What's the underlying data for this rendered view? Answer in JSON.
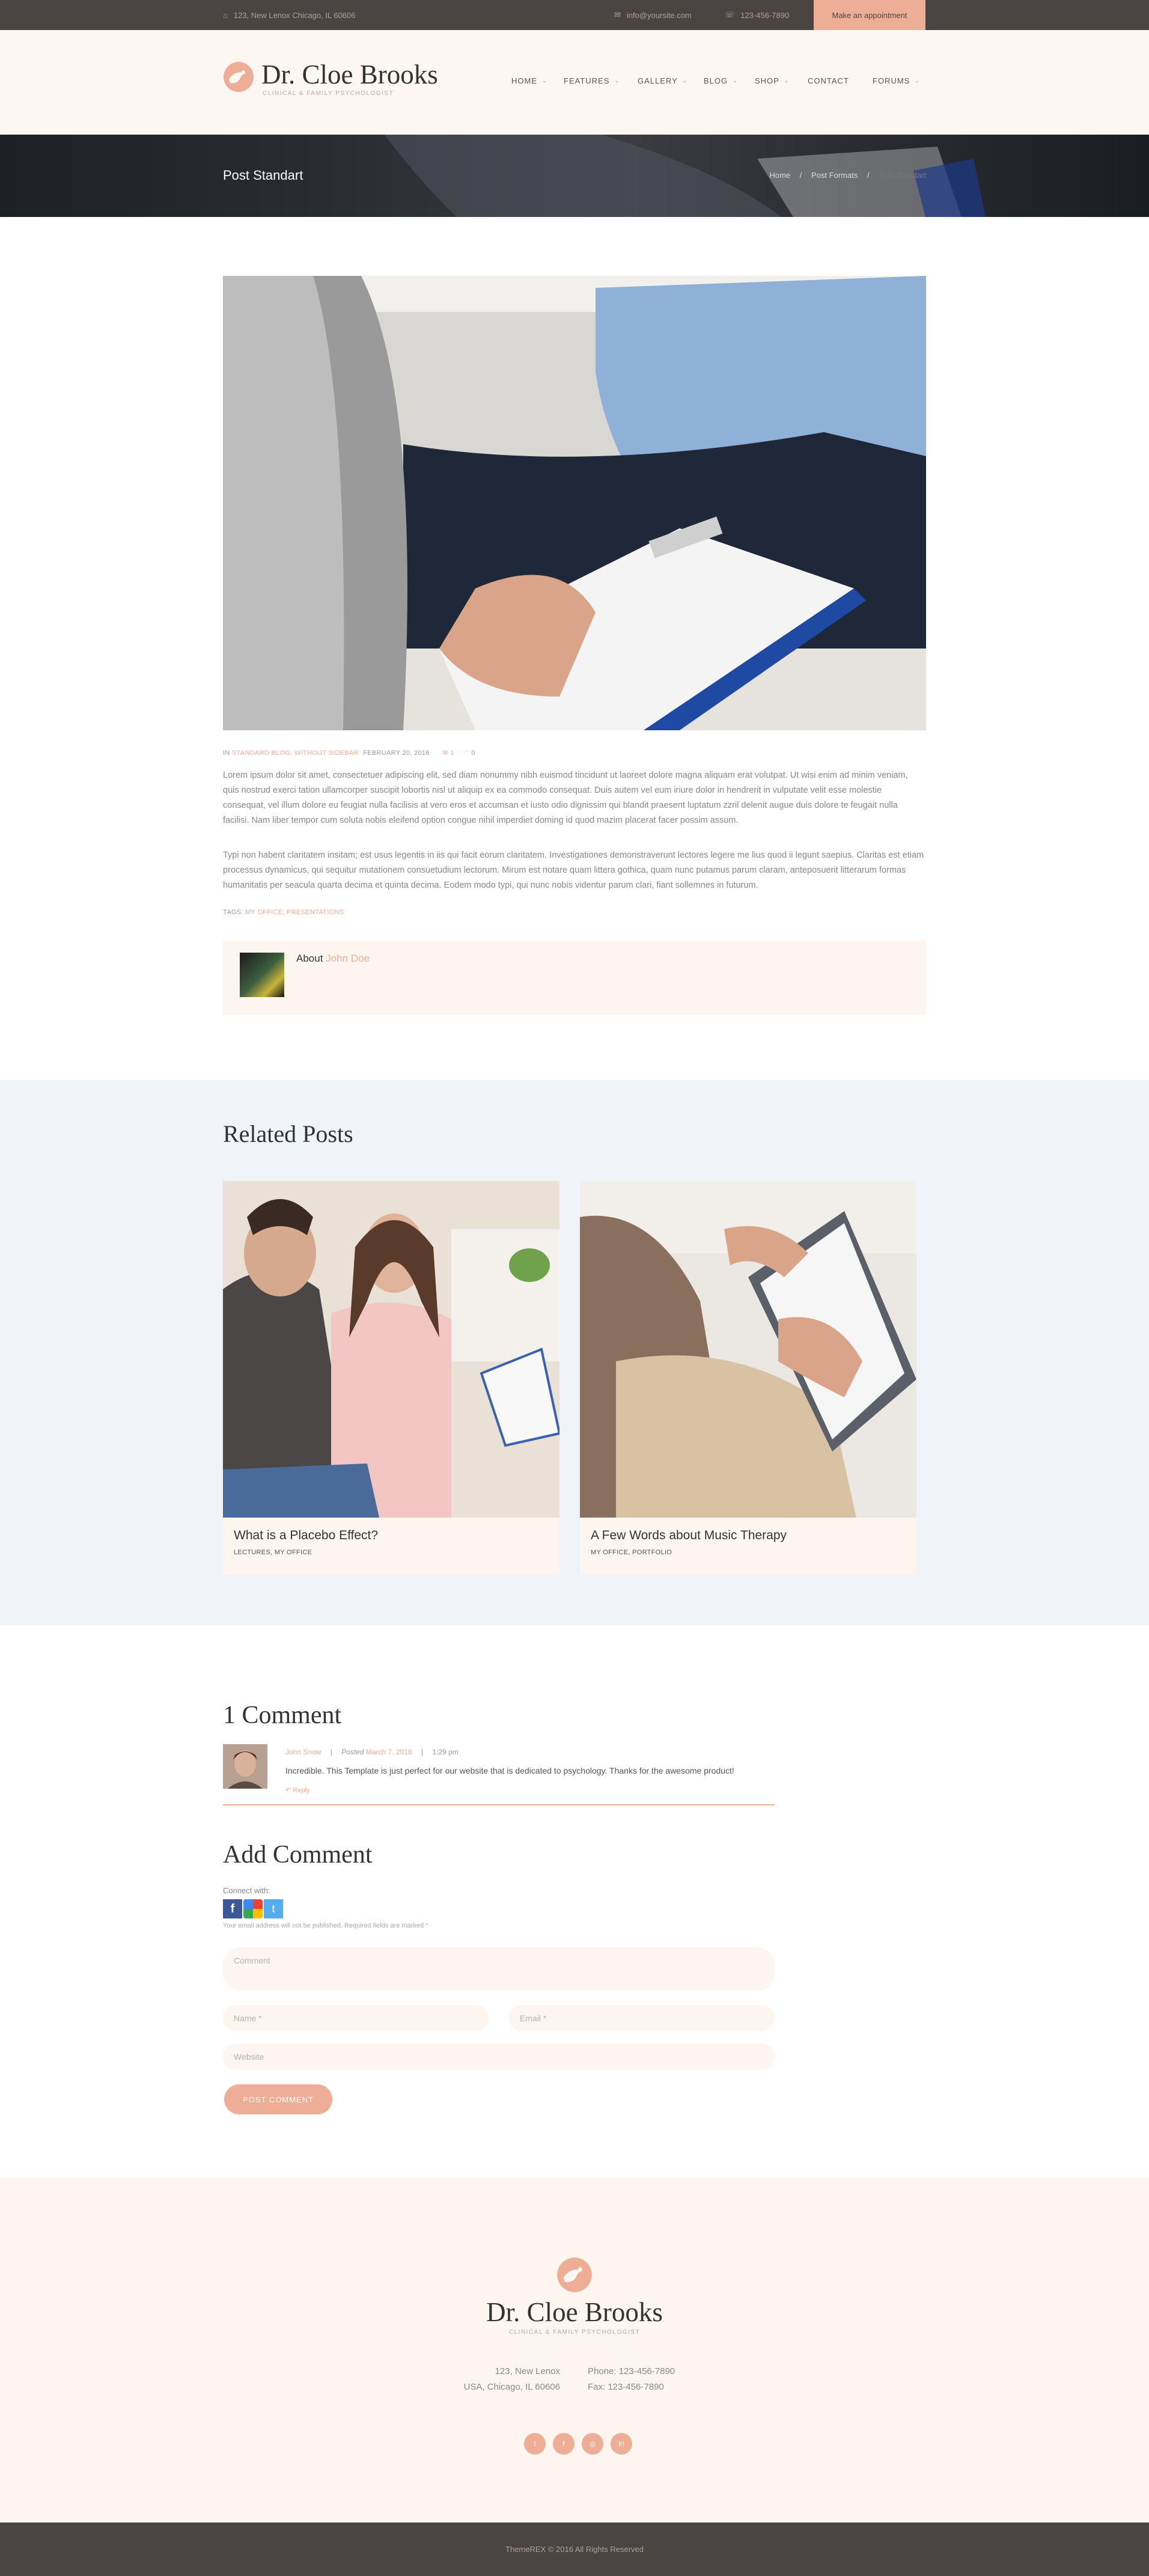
{
  "topbar": {
    "address": "123, New Lenox Chicago, IL 60606",
    "email": "info@yoursite.com",
    "phone": "123-456-7890",
    "appointment_label": "Make an appointment"
  },
  "brand": {
    "name": "Dr. Cloe Brooks",
    "tagline": "CLINICAL & FAMILY PSYCHOLOGIST"
  },
  "nav": [
    {
      "label": "HOME",
      "has_dropdown": true
    },
    {
      "label": "FEATURES",
      "has_dropdown": true
    },
    {
      "label": "GALLERY",
      "has_dropdown": true
    },
    {
      "label": "BLOG",
      "has_dropdown": true
    },
    {
      "label": "SHOP",
      "has_dropdown": true
    },
    {
      "label": "CONTACT",
      "has_dropdown": false
    },
    {
      "label": "FORUMS",
      "has_dropdown": true
    }
  ],
  "page": {
    "title": "Post Standart",
    "breadcrumb": [
      "Home",
      "Post Formats",
      "Post Standart"
    ]
  },
  "post": {
    "meta_prefix": "IN",
    "categories": "STANDARD BLOG, WITHOUT SIDEBAR",
    "date": "FEBRUARY 20, 2016",
    "comments_count": "1",
    "likes_count": "0",
    "paragraph1": "Lorem ipsum dolor sit amet, consectetuer adipiscing elit, sed diam nonummy nibh euismod tincidunt ut laoreet dolore magna aliquam erat volutpat. Ut wisi enim ad minim veniam, quis nostrud exerci tation ullamcorper suscipit lobortis nisl ut aliquip ex ea commodo consequat. Duis autem vel eum iriure dolor in hendrerit in vulputate velit esse molestie consequat, vel illum dolore eu feugiat nulla facilisis at vero eros et accumsan et iusto odio dignissim qui blandit praesent luptatum zzril delenit augue duis dolore te feugait nulla facilisi. Nam liber tempor cum soluta nobis eleifend option congue nihil imperdiet doming id quod mazim placerat facer possim assum.",
    "paragraph2": "Typi non habent claritatem insitam; est usus legentis in iis qui facit eorum claritatem. Investigationes demonstraverunt lectores legere me lius quod ii legunt saepius. Claritas est etiam processus dynamicus, qui sequitur mutationem consuetudium lectorum. Mirum est notare quam littera gothica, quam nunc putamus parum claram, anteposuerit litterarum formas humanitatis per seacula quarta decima et quinta decima. Eodem modo typi, qui nunc nobis videntur parum clari, fiant sollemnes in futurum.",
    "tags_prefix": "TAGS:",
    "tags": "MY OFFICE, PRESENTATIONS",
    "author_prefix": "About",
    "author_name": "John Doe"
  },
  "related": {
    "heading": "Related Posts",
    "posts": [
      {
        "title": "What is a Placebo Effect?",
        "categories": "LECTURES, MY OFFICE"
      },
      {
        "title": "A Few Words about Music Therapy",
        "categories": "MY OFFICE, PORTFOLIO"
      }
    ]
  },
  "comments": {
    "heading": "1 Comment",
    "items": [
      {
        "author": "John Snow",
        "posted_label": "Posted",
        "date": "March 7, 2016",
        "time": "1:29 pm",
        "text": "Incredible. This Template is just perfect for our website that is dedicated to psychology. Thanks for the awesome product!",
        "reply_label": "Reply"
      }
    ]
  },
  "add_comment": {
    "heading": "Add Comment",
    "connect_label": "Connect with:",
    "notice": "Your email address will not be published. Required fields are marked *",
    "comment_placeholder": "Comment",
    "name_placeholder": "Name *",
    "email_placeholder": "Email *",
    "website_placeholder": "Website",
    "submit_label": "POST COMMENT"
  },
  "footer": {
    "name": "Dr. Cloe Brooks",
    "tagline": "CLINICAL & FAMILY PSYCHOLOGIST",
    "address_line1": "123, New Lenox",
    "address_line2": "USA, Chicago, IL 60606",
    "phone": "Phone: 123-456-7890",
    "fax": "Fax: 123-456-7890",
    "social": [
      "twitter-icon",
      "facebook-icon",
      "dribbble-icon",
      "linkedin-icon"
    ],
    "copyright": "ThemeREX © 2016 All Rights Reserved"
  },
  "colors": {
    "accent": "#eeae95",
    "dark": "#4a4543",
    "cream": "#fcf7f2",
    "light_blue": "#f0f4f8"
  }
}
